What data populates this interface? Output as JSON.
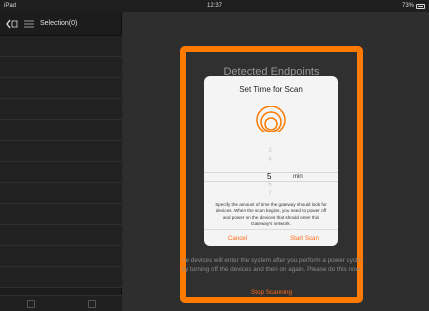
{
  "status_bar": {
    "carrier": "iPad",
    "time": "12:37",
    "battery": "73%"
  },
  "sidebar": {
    "header_label": "Selection(0)"
  },
  "main": {
    "background_title": "Detected Endpoints",
    "background_description": "ne devices will enter the system after you perform a power cycle by turning off the devices and then on again. Please do this now.",
    "stop_scanning_label": "Stop Scanning"
  },
  "dialog": {
    "title": "Set Time for Scan",
    "picker": {
      "numbers": [
        "3",
        "4",
        "6",
        "7"
      ],
      "selected": "5",
      "unit": "min"
    },
    "description": "Specify the amount of time the gateway should look for devices. When the scan begins, you need to power off and power on the devices that should enter this Gateway's network.",
    "cancel_label": "Cancel",
    "start_label": "Start Scan"
  },
  "colors": {
    "accent": "#ff6a1a",
    "highlight": "#ff7a00"
  }
}
